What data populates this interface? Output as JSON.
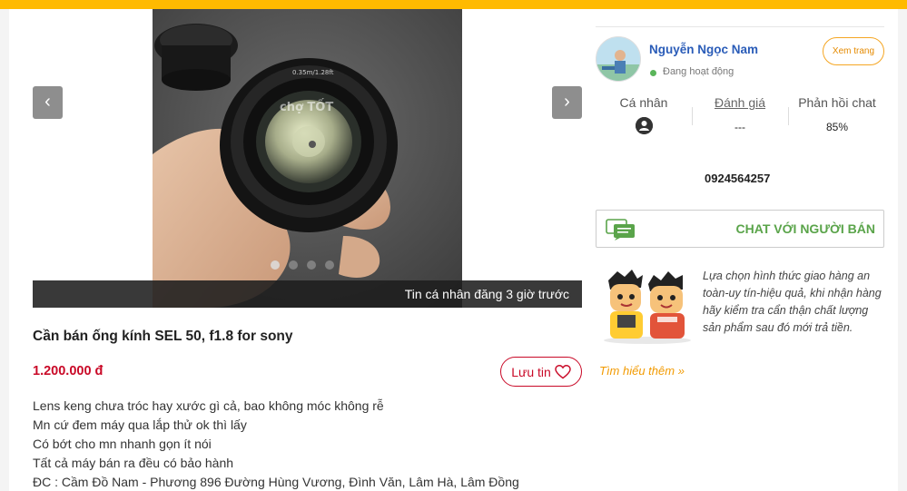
{
  "gallery": {
    "caption": "Tin cá nhân đăng 3 giờ trước",
    "prev_icon": "‹",
    "next_icon": "›",
    "dots_count": 4,
    "active_dot": 1,
    "lens_text": "0.35m/1.28ft",
    "watermark": "chợ TỐT"
  },
  "listing": {
    "title": "Cần bán ống kính SEL 50, f1.8 for sony",
    "price": "1.200.000 đ",
    "save_label": "Lưu tin",
    "description": [
      "Lens keng chưa tróc hay xước gì cả, bao không móc không rễ",
      "Mn cứ đem máy qua lắp thử ok thì lấy",
      "Có bớt cho mn nhanh gọn ít nói",
      "Tất cả máy bán ra đều có bảo hành",
      "ĐC : Cầm Đồ Nam - Phương 896 Đường Hùng Vương, Đình Văn, Lâm Hà, Lâm Đồng"
    ]
  },
  "seller": {
    "name": "Nguyễn Ngọc Nam",
    "status": "Đang hoạt động",
    "view_page_label": "Xem trang",
    "stats": {
      "personal_label": "Cá nhân",
      "rating_label": "Đánh giá",
      "rating_value": "---",
      "response_label": "Phản hồi chat",
      "response_value": "85%"
    },
    "phone": "0924564257",
    "chat_label": "CHAT VỚI NGƯỜI BÁN"
  },
  "tips": {
    "text": "Lựa chọn hình thức giao hàng an toàn-uy tín-hiệu quả, khi nhận hàng hãy kiểm tra cẩn thận chất lượng sản phẩm sau đó mới trả tiền.",
    "learn_more": "Tìm hiểu thêm »"
  },
  "colors": {
    "topbar": "#ffba00",
    "price": "#c90927",
    "seller_name": "#2a5cb8",
    "chat": "#5aa44a",
    "learn_more": "#f29a00"
  }
}
